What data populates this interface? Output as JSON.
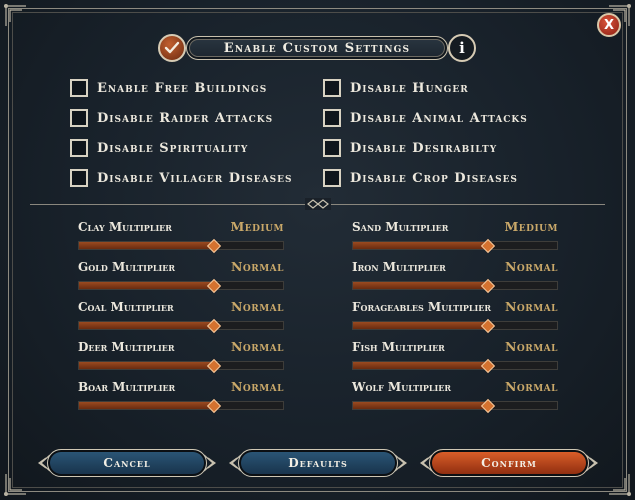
{
  "window": {
    "title": "Enable Custom Settings",
    "close_label": "X",
    "info_label": "i"
  },
  "options": [
    {
      "label": "Enable Free Buildings",
      "checked": false
    },
    {
      "label": "Disable Hunger",
      "checked": false
    },
    {
      "label": "Disable Raider Attacks",
      "checked": false
    },
    {
      "label": "Disable Animal Attacks",
      "checked": false
    },
    {
      "label": "Disable Spirituality",
      "checked": false
    },
    {
      "label": "Disable Desirabilty",
      "checked": false
    },
    {
      "label": "Disable Villager Diseases",
      "checked": false
    },
    {
      "label": "Disable Crop Diseases",
      "checked": false
    }
  ],
  "multipliers": [
    {
      "label": "Clay Multiplier",
      "value": "Medium",
      "level": 0.66
    },
    {
      "label": "Sand Multiplier",
      "value": "Medium",
      "level": 0.66
    },
    {
      "label": "Gold Multiplier",
      "value": "Normal",
      "level": 0.66
    },
    {
      "label": "Iron Multiplier",
      "value": "Normal",
      "level": 0.66
    },
    {
      "label": "Coal Multiplier",
      "value": "Normal",
      "level": 0.66
    },
    {
      "label": "Forageables Multiplier",
      "value": "Normal",
      "level": 0.66
    },
    {
      "label": "Deer Multiplier",
      "value": "Normal",
      "level": 0.66
    },
    {
      "label": "Fish Multiplier",
      "value": "Normal",
      "level": 0.66
    },
    {
      "label": "Boar Multiplier",
      "value": "Normal",
      "level": 0.66
    },
    {
      "label": "Wolf Multiplier",
      "value": "Normal",
      "level": 0.66
    }
  ],
  "buttons": {
    "cancel": "Cancel",
    "defaults": "Defaults",
    "confirm": "Confirm"
  },
  "colors": {
    "accent_orange": "#d4722f",
    "value_gold": "#c9a869",
    "button_blue": "#2c5879",
    "button_red": "#e0622b"
  }
}
